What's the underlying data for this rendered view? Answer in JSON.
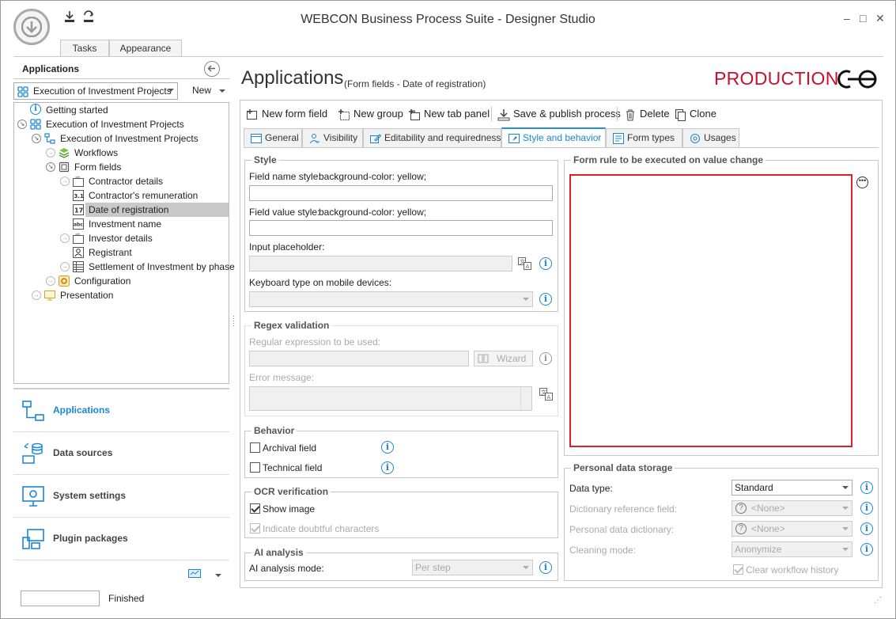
{
  "window": {
    "title": "WEBCON Business Process Suite - Designer Studio",
    "minimize": "–",
    "maximize": "□",
    "close": "✕"
  },
  "ribbon_tabs": [
    "Tasks",
    "Appearance"
  ],
  "left": {
    "header": "Applications",
    "app_selector": "Execution of Investment Projects",
    "new_label": "New",
    "tree": [
      {
        "label": "Getting started",
        "icon": "info-icon"
      },
      {
        "label": "Execution of Investment Projects",
        "icon": "app-icon"
      },
      {
        "label": "Execution of Investment Projects",
        "icon": "process-icon"
      },
      {
        "label": "Workflows",
        "icon": "workflows-icon"
      },
      {
        "label": "Form fields",
        "icon": "form-fields-icon"
      },
      {
        "label": "Contractor details",
        "icon": "text-field-icon"
      },
      {
        "label": "Contractor's remuneration",
        "icon": "decimal-field-icon"
      },
      {
        "label": "Date of registration",
        "icon": "date-field-icon"
      },
      {
        "label": "Investment name",
        "icon": "abc-field-icon"
      },
      {
        "label": "Investor details",
        "icon": "text-field-icon"
      },
      {
        "label": "Registrant",
        "icon": "person-field-icon"
      },
      {
        "label": "Settlement of Investment by phase",
        "icon": "grid-field-icon"
      },
      {
        "label": "Configuration",
        "icon": "configuration-icon"
      },
      {
        "label": "Presentation",
        "icon": "presentation-icon"
      }
    ],
    "nav": [
      {
        "label": "Applications",
        "icon": "applications-icon"
      },
      {
        "label": "Data sources",
        "icon": "data-sources-icon"
      },
      {
        "label": "System settings",
        "icon": "system-settings-icon"
      },
      {
        "label": "Plugin packages",
        "icon": "plugin-packages-icon"
      }
    ],
    "status": "Finished"
  },
  "main": {
    "title": "Applications",
    "subtitle": "(Form fields - Date of registration)",
    "environment": "PRODUCTION",
    "toolbar": {
      "new_form_field": "New form field",
      "new_group": "New group",
      "new_tab_panel": "New tab panel",
      "save_publish": "Save & publish process",
      "delete": "Delete",
      "clone": "Clone"
    },
    "tabs": [
      "General",
      "Visibility",
      "Editability and requiredness",
      "Style and behavior",
      "Form types",
      "Usages"
    ],
    "active_tab": "Style and behavior",
    "style": {
      "group": "Style",
      "field_name_style_label": "Field name style:",
      "field_name_style_value": "background-color: yellow;",
      "field_value_style_label": "Field value style:",
      "field_value_style_value": "background-color: yellow;",
      "input_placeholder_label": "Input placeholder:",
      "keyboard_type_label": "Keyboard type on mobile devices:"
    },
    "regex": {
      "group": "Regex validation",
      "regex_label": "Regular expression to be used:",
      "wizard": "Wizard",
      "error_label": "Error message:"
    },
    "behavior": {
      "group": "Behavior",
      "archival_field": "Archival field",
      "technical_field": "Technical field"
    },
    "ocr": {
      "group": "OCR verification",
      "show_image": "Show image",
      "indicate_doubtful": "Indicate doubtful characters"
    },
    "ai": {
      "group": "AI analysis",
      "mode_label": "AI analysis mode:",
      "mode_value": "Per step"
    },
    "form_rule": {
      "group": "Form rule to be executed on value change"
    },
    "personal": {
      "group": "Personal data storage",
      "data_type_label": "Data type:",
      "data_type_value": "Standard",
      "dict_ref_label": "Dictionary reference field:",
      "dict_ref_value": "<None>",
      "personal_dict_label": "Personal data dictionary:",
      "personal_dict_value": "<None>",
      "cleaning_label": "Cleaning mode:",
      "cleaning_value": "Anonymize",
      "clear_history": "Clear workflow history"
    }
  }
}
